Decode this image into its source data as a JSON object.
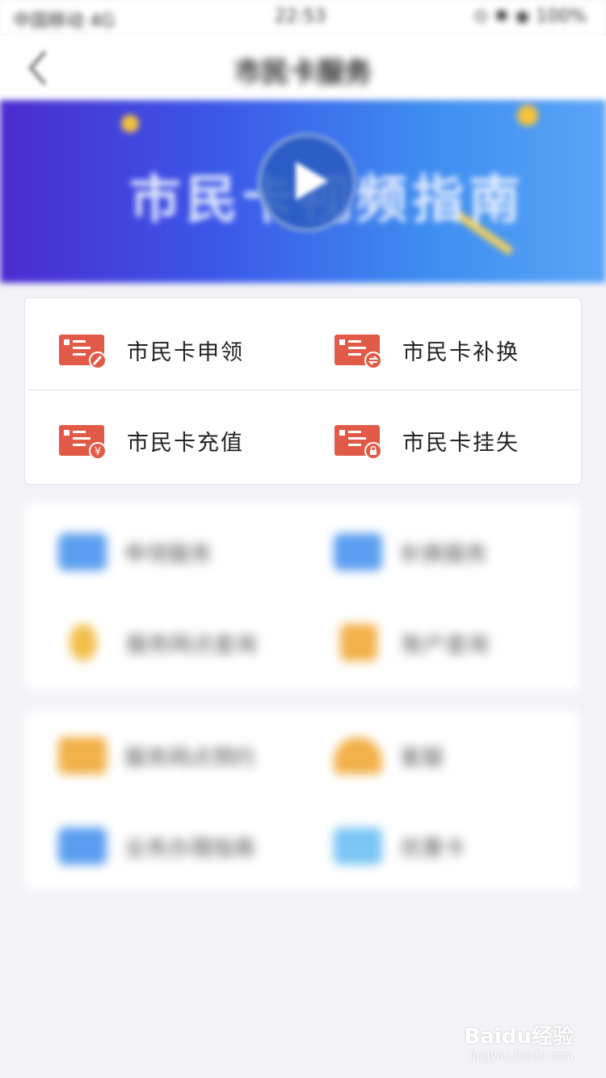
{
  "status_bar": {
    "carrier": "中国移动 4G",
    "time": "22:53",
    "right": "⊙ ✱ ◉ 100%"
  },
  "header": {
    "title": "市民卡服务"
  },
  "banner": {
    "text": "市民卡视频指南"
  },
  "main_services": [
    {
      "label": "市民卡申领",
      "icon": "card-apply-icon"
    },
    {
      "label": "市民卡补换",
      "icon": "card-replace-icon"
    },
    {
      "label": "市民卡充值",
      "icon": "card-recharge-icon"
    },
    {
      "label": "市民卡挂失",
      "icon": "card-report-loss-icon"
    }
  ],
  "blurred_section_1": [
    {
      "label": "申领服务",
      "color": "#5b9ef0"
    },
    {
      "label": "补换服务",
      "color": "#5b9ef0"
    },
    {
      "label": "服务网点查询",
      "color": "#f2bf4b"
    },
    {
      "label": "账户查询",
      "color": "#f2b14a"
    }
  ],
  "blurred_section_2": [
    {
      "label": "服务网点预约",
      "color": "#f2b14a"
    },
    {
      "label": "客服",
      "color": "#f2b14a"
    },
    {
      "label": "业务办理指南",
      "color": "#5b9ef0"
    },
    {
      "label": "优惠卡",
      "color": "#7cc6f5"
    }
  ],
  "watermark": {
    "main": "Baidu经验",
    "sub": "jingyan.baidu.com"
  },
  "colors": {
    "card_icon": "#e05a47",
    "accent_blue": "#3b6fe6"
  }
}
